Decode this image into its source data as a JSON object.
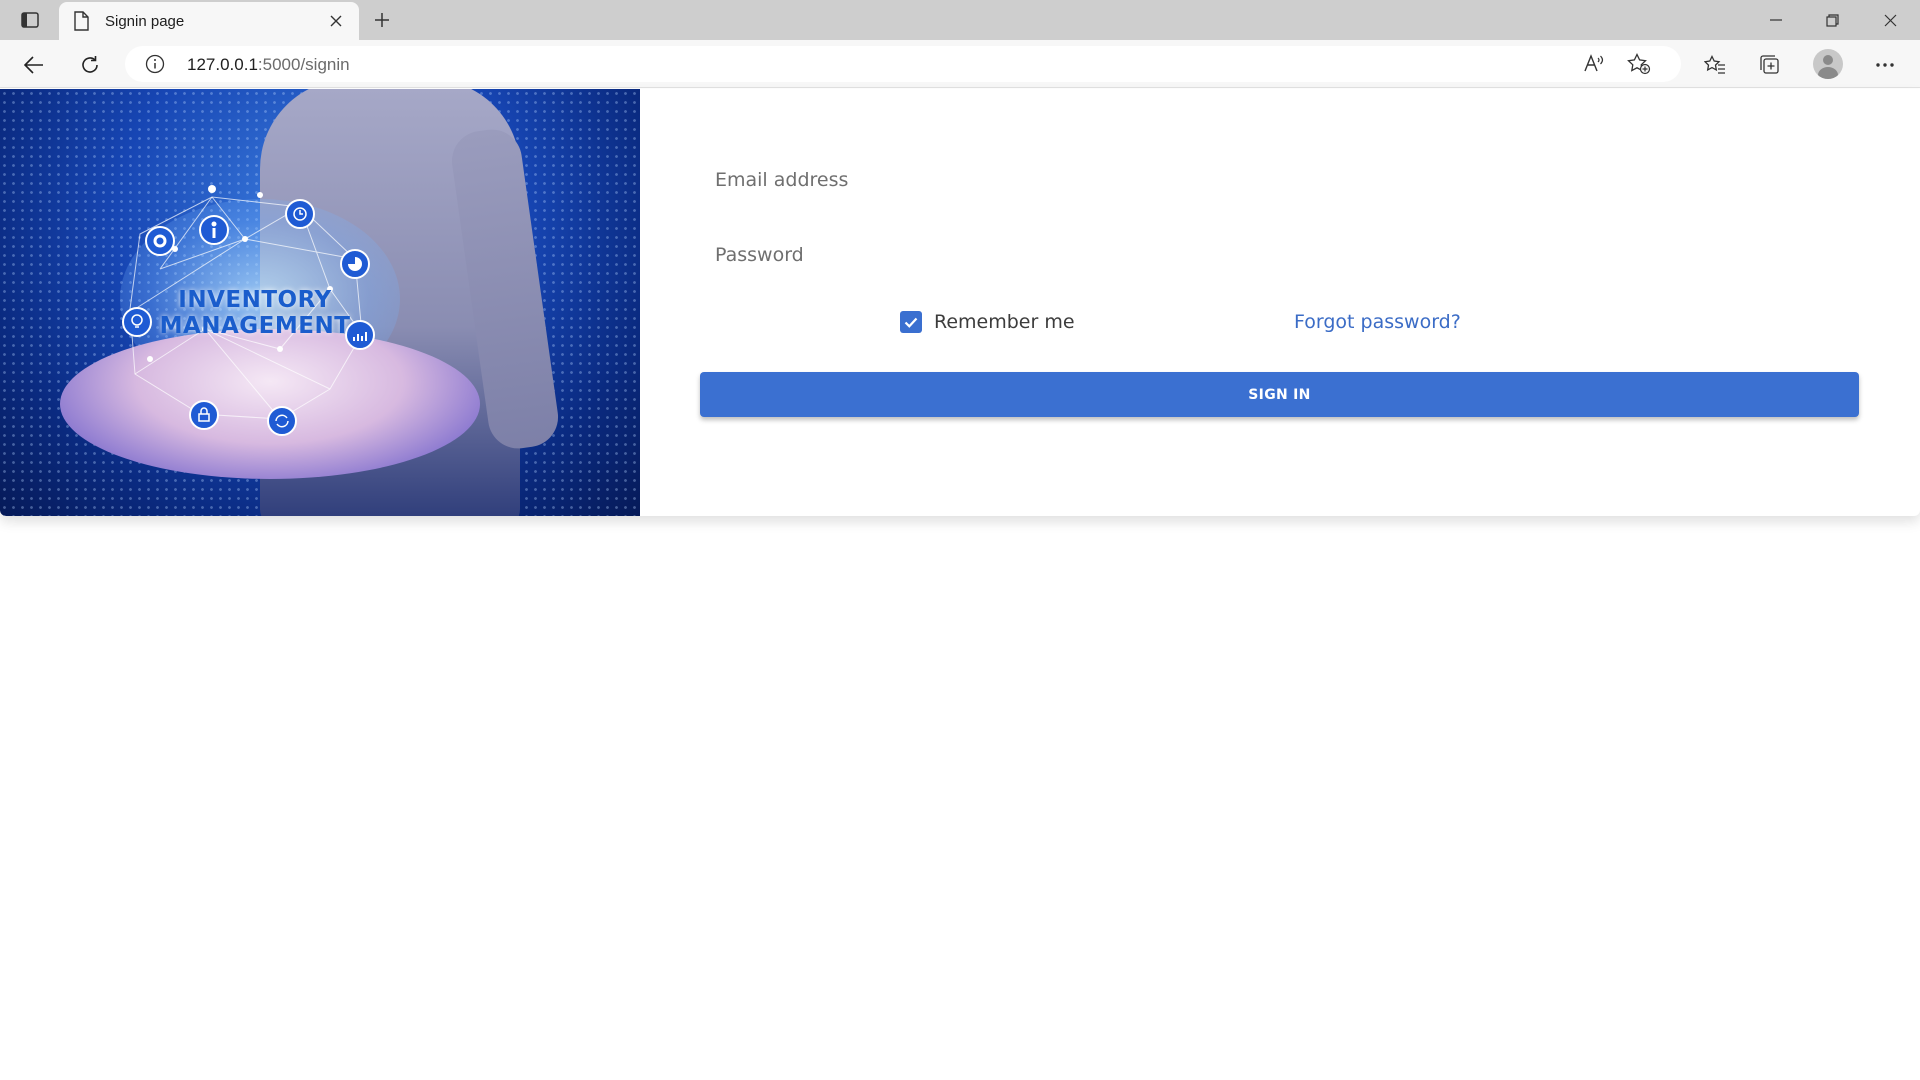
{
  "browser": {
    "tab": {
      "title": "Signin page"
    },
    "address": {
      "host": "127.0.0.1",
      "path": ":5000/signin"
    }
  },
  "hero": {
    "image_title_line1": "INVENTORY",
    "image_title_line2": "MANAGEMENT"
  },
  "signin_form": {
    "email_placeholder": "Email address",
    "email_value": "",
    "password_placeholder": "Password",
    "password_value": "",
    "remember_label": "Remember me",
    "remember_checked": true,
    "forgot_label": "Forgot password?",
    "submit_label": "SIGN IN"
  },
  "colors": {
    "primary": "#3b70d1",
    "link": "#3b6cc6",
    "checkbox": "#3a6fd0"
  }
}
